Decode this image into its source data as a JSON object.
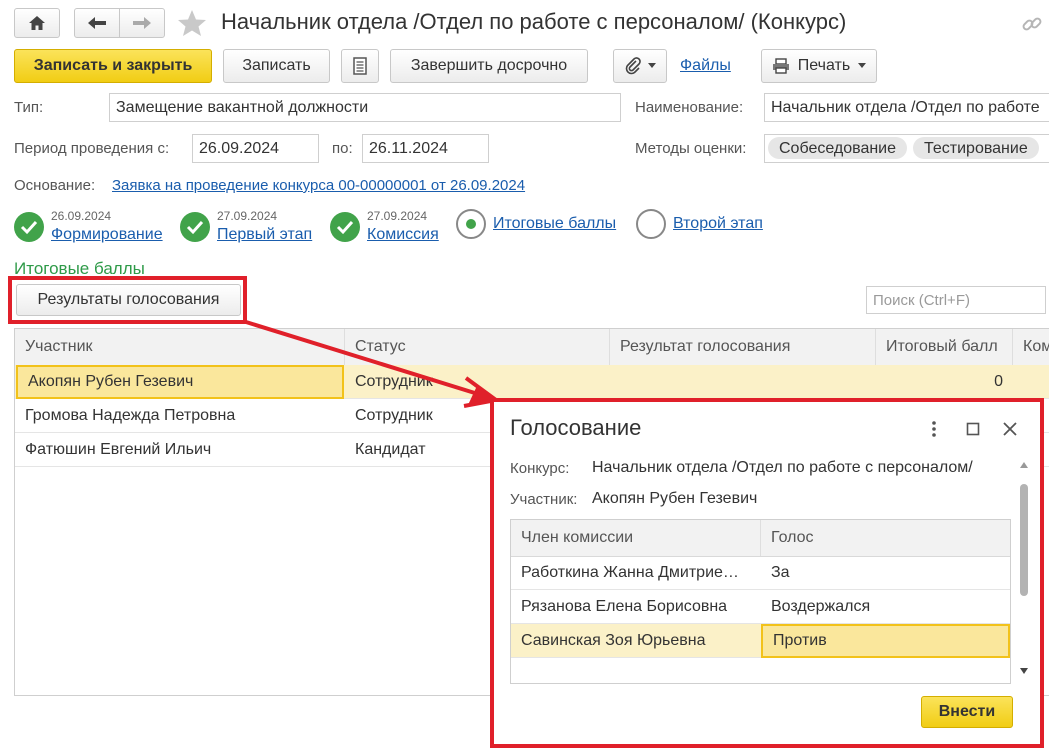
{
  "window": {
    "title": "Начальник отдела /Отдел по работе с персоналом/ (Конкурс)"
  },
  "toolbar": {
    "save_close": "Записать и закрыть",
    "save": "Записать",
    "finish_early": "Завершить досрочно",
    "files": "Файлы",
    "print": "Печать"
  },
  "form": {
    "type_label": "Тип:",
    "type_value": "Замещение вакантной должности",
    "name_label": "Наименование:",
    "name_value": "Начальник отдела /Отдел по работе",
    "period_label": "Период проведения с:",
    "period_from": "26.09.2024",
    "period_to_label": "по:",
    "period_to": "26.11.2024",
    "methods_label": "Методы оценки:",
    "methods": [
      "Собеседование",
      "Тестирование"
    ],
    "basis_label": "Основание:",
    "basis_link": "Заявка на проведение конкурса 00-00000001 от 26.09.2024"
  },
  "stages": [
    {
      "date": "26.09.2024",
      "label": "Формирование",
      "state": "done"
    },
    {
      "date": "27.09.2024",
      "label": "Первый этап",
      "state": "done"
    },
    {
      "date": "27.09.2024",
      "label": "Комиссия",
      "state": "done"
    },
    {
      "date": "",
      "label": "Итоговые баллы",
      "state": "current"
    },
    {
      "date": "",
      "label": "Второй этап",
      "state": "pending"
    }
  ],
  "section": {
    "title": "Итоговые баллы",
    "voting_results_button": "Результаты голосования",
    "search_placeholder": "Поиск (Ctrl+F)"
  },
  "table": {
    "columns": [
      "Участник",
      "Статус",
      "Результат голосования",
      "Итоговый балл",
      "Ком"
    ],
    "rows": [
      {
        "participant": "Акопян Рубен Гезевич",
        "status": "Сотрудник",
        "result": "",
        "score": "0"
      },
      {
        "participant": "Громова Надежда Петровна",
        "status": "Сотрудник",
        "result": "",
        "score": ""
      },
      {
        "participant": "Фатюшин Евгений Ильич",
        "status": "Кандидат",
        "result": "",
        "score": ""
      }
    ]
  },
  "modal": {
    "title": "Голосование",
    "contest_label": "Конкурс:",
    "contest_value": "Начальник отдела /Отдел по работе с персоналом/",
    "participant_label": "Участник:",
    "participant_value": "Акопян Рубен Гезевич",
    "columns": [
      "Член комиссии",
      "Голос"
    ],
    "rows": [
      {
        "member": "Работкина Жанна Дмитрие…",
        "vote": "За"
      },
      {
        "member": "Рязанова Елена Борисовна",
        "vote": "Воздержался"
      },
      {
        "member": "Савинская Зоя Юрьевна",
        "vote": "Против"
      }
    ],
    "submit": "Внести"
  },
  "colors": {
    "accent_yellow": "#f1cd14",
    "success_green": "#41a34a",
    "link_blue": "#1a5dad",
    "section_green": "#2e9a48",
    "highlight_red": "#e0202a",
    "selected_row": "#fbf1c8"
  }
}
